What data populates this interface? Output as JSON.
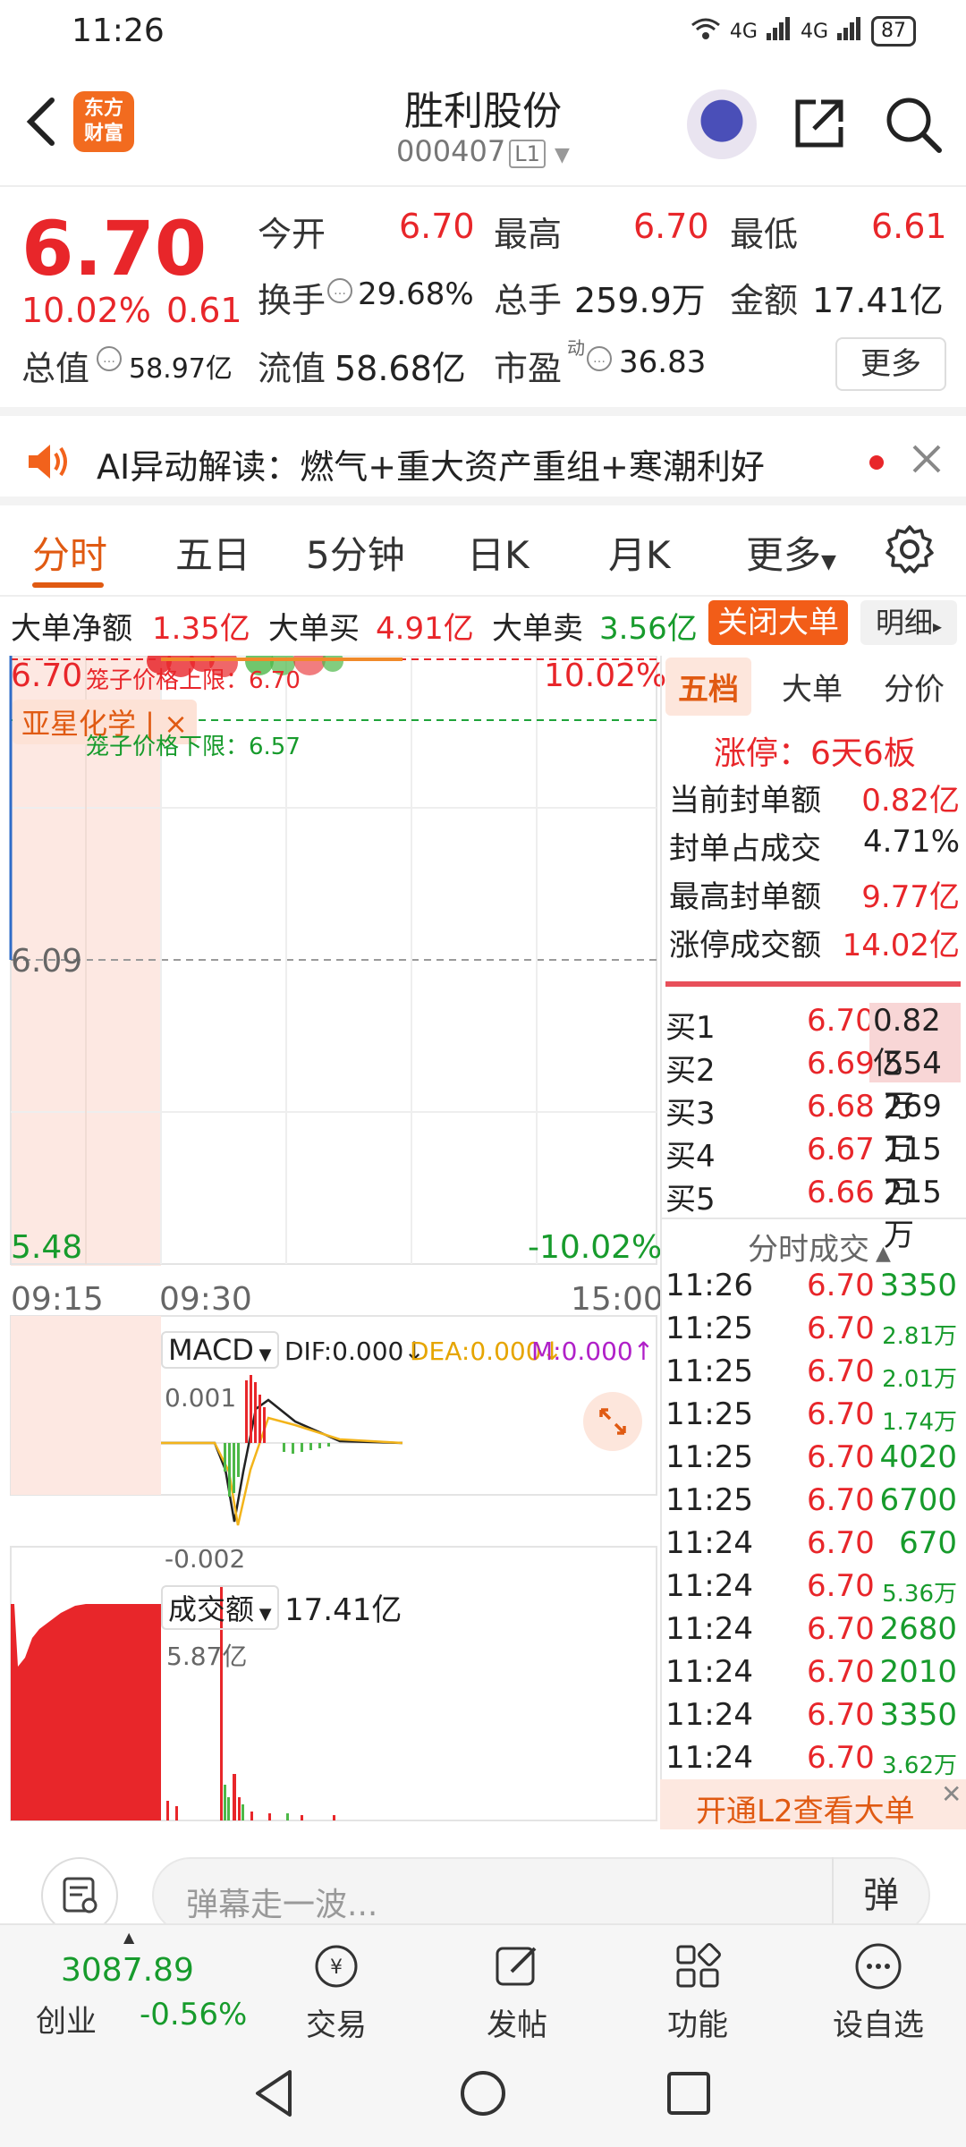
{
  "status": {
    "time": "11:26",
    "signal1": "4G",
    "signal2": "4G",
    "battery": "87"
  },
  "header": {
    "back_label": "<",
    "logo_text_1": "东方",
    "logo_text_2": "财富",
    "title": "胜利股份",
    "code": "000407",
    "level": "L1"
  },
  "quote": {
    "price": "6.70",
    "change_pct": "10.02%",
    "change": "0.61",
    "open_label": "今开",
    "open": "6.70",
    "high_label": "最高",
    "high": "6.70",
    "low_label": "最低",
    "low": "6.61",
    "turnover_label": "换手",
    "turnover": "29.68%",
    "volume_label": "总手",
    "volume": "259.9万",
    "amount_label": "金额",
    "amount": "17.41亿",
    "mktcap_label": "总值",
    "mktcap": "58.97亿",
    "float_label": "流值",
    "float_cap": "58.68亿",
    "pe_label": "市盈",
    "pe_super": "动",
    "pe": "36.83",
    "more_label": "更多"
  },
  "ai": {
    "text": "AI异动解读：燃气+重大资产重组+寒潮利好"
  },
  "tabs": [
    "分时",
    "五日",
    "5分钟",
    "日K",
    "月K",
    "更多"
  ],
  "bigorder": {
    "net_label": "大单净额",
    "net": "1.35亿",
    "buy_label": "大单买",
    "buy": "4.91亿",
    "sell_label": "大单卖",
    "sell": "3.56亿",
    "close_label": "关闭大单",
    "detail_label": "明细"
  },
  "chart": {
    "top_price": "6.70",
    "top_pct": "10.02%",
    "mid_price": "6.09",
    "bottom_price": "5.48",
    "bottom_pct": "-10.02%",
    "cage_upper": "笼子价格上限：6.70",
    "cage_lower": "笼子价格下限：6.57",
    "overlay_tag": "亚星化学 | ×",
    "times": [
      "09:15",
      "09:30",
      "15:00"
    ],
    "macd_label": "MACD",
    "dif": "DIF:0.000↓",
    "dea": "DEA:0.000↓",
    "m": "M:0.000↑",
    "macd_top": "0.001",
    "macd_bottom": "-0.002",
    "vol_label": "成交额",
    "vol_total": "17.41亿",
    "vol_max": "5.87亿"
  },
  "rpanel": {
    "tabs": [
      "五档",
      "大单",
      "分价"
    ],
    "limit_title": "涨停：6天6板",
    "stats": [
      {
        "label": "当前封单额",
        "value": "0.82亿"
      },
      {
        "label": "封单占成交",
        "value": "4.71%"
      },
      {
        "label": "最高封单额",
        "value": "9.77亿"
      },
      {
        "label": "涨停成交额",
        "value": "14.02亿"
      }
    ],
    "book": [
      {
        "label": "买1",
        "price": "6.70",
        "vol": "0.82亿"
      },
      {
        "label": "买2",
        "price": "6.69",
        "vol": "554万"
      },
      {
        "label": "买3",
        "price": "6.68",
        "vol": "269万"
      },
      {
        "label": "买4",
        "price": "6.67",
        "vol": "115万"
      },
      {
        "label": "买5",
        "price": "6.66",
        "vol": "215万"
      }
    ],
    "ticks_title": "分时成交",
    "ticks": [
      {
        "t": "11:26",
        "p": "6.70",
        "v": "3350"
      },
      {
        "t": "11:25",
        "p": "6.70",
        "v": "2.81万"
      },
      {
        "t": "11:25",
        "p": "6.70",
        "v": "2.01万"
      },
      {
        "t": "11:25",
        "p": "6.70",
        "v": "1.74万"
      },
      {
        "t": "11:25",
        "p": "6.70",
        "v": "4020"
      },
      {
        "t": "11:25",
        "p": "6.70",
        "v": "6700"
      },
      {
        "t": "11:24",
        "p": "6.70",
        "v": "670"
      },
      {
        "t": "11:24",
        "p": "6.70",
        "v": "5.36万"
      },
      {
        "t": "11:24",
        "p": "6.70",
        "v": "2680"
      },
      {
        "t": "11:24",
        "p": "6.70",
        "v": "2010"
      },
      {
        "t": "11:24",
        "p": "6.70",
        "v": "3350"
      },
      {
        "t": "11:24",
        "p": "6.70",
        "v": "3.62万"
      }
    ],
    "l2_text": "开通L2查看大单"
  },
  "danmu": {
    "placeholder": "弹幕走一波...",
    "button": "弹"
  },
  "bottom": {
    "index_value": "3087.89",
    "index_name": "创业",
    "index_change": "-0.56%",
    "items": [
      "交易",
      "发帖",
      "功能",
      "设自选"
    ]
  }
}
